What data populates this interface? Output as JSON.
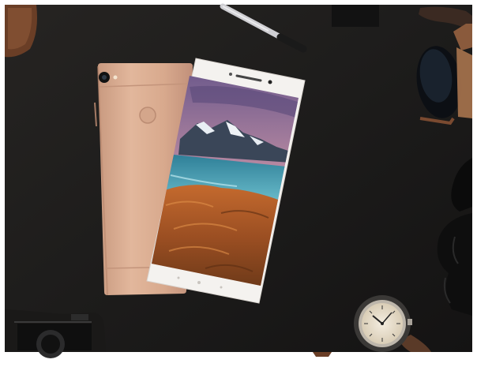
{
  "scene": {
    "description_free": true,
    "colors": {
      "surface": "#1c1b1a",
      "phone_gold": "#dcae94",
      "phone_front": "#f3f1ee",
      "sky_top": "#7e6a9a",
      "sea": "#4aa2b6",
      "grass": "#a65a2a"
    },
    "icons": [
      "camera-lens-icon",
      "fingerprint-icon",
      "watch-icon",
      "pen-icon",
      "sunglasses-icon",
      "glove-icon",
      "camera-icon"
    ]
  }
}
